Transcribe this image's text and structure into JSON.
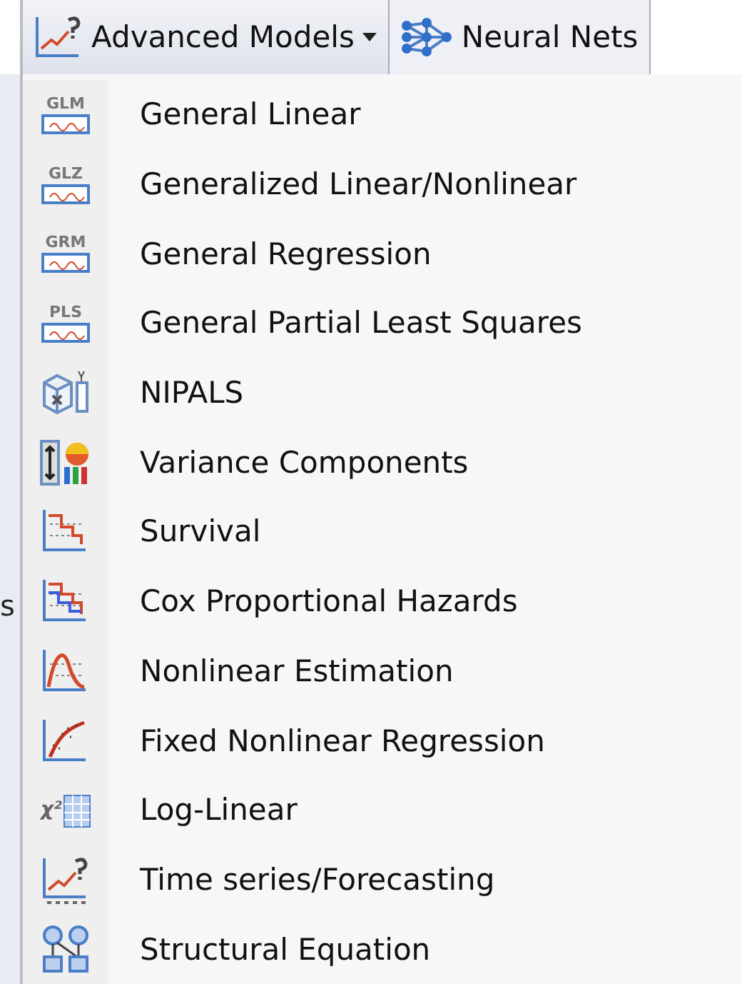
{
  "toolbar": {
    "tabs": [
      {
        "label": "Advanced Models",
        "selected": true,
        "dropdown": true
      },
      {
        "label": "Neural Nets",
        "selected": false,
        "dropdown": false
      }
    ]
  },
  "background": {
    "text": "s"
  },
  "menu": {
    "items": [
      {
        "label": "General Linear",
        "kind": "labeled",
        "icon_text": "GLM"
      },
      {
        "label": "Generalized Linear/Nonlinear",
        "kind": "labeled",
        "icon_text": "GLZ"
      },
      {
        "label": "General Regression",
        "kind": "labeled",
        "icon_text": "GRM"
      },
      {
        "label": "General Partial Least Squares",
        "kind": "labeled",
        "icon_text": "PLS"
      },
      {
        "label": "NIPALS",
        "kind": "cube"
      },
      {
        "label": "Variance Components",
        "kind": "variance"
      },
      {
        "label": "Survival",
        "kind": "step"
      },
      {
        "label": "Cox Proportional Hazards",
        "kind": "steps"
      },
      {
        "label": "Nonlinear Estimation",
        "kind": "peak"
      },
      {
        "label": "Fixed Nonlinear Regression",
        "kind": "curve"
      },
      {
        "label": "Log-Linear",
        "kind": "chi",
        "icon_text": "χ²"
      },
      {
        "label": "Time series/Forecasting",
        "kind": "trend"
      },
      {
        "label": "Structural Equation",
        "kind": "nodes"
      }
    ]
  }
}
